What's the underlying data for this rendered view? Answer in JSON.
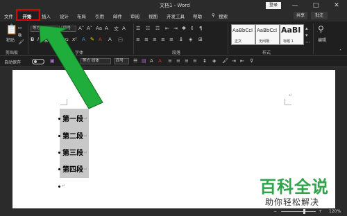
{
  "window": {
    "title": "文档1 - Word",
    "login_label": "登录",
    "controls": [
      "—",
      "□",
      "✕"
    ]
  },
  "tabs": {
    "file": "文件",
    "home": "开始",
    "insert": "插入",
    "design": "设计",
    "layout": "布局",
    "references": "引用",
    "mailings": "邮件",
    "review": "审阅",
    "view": "视图",
    "developer": "开发工具",
    "help": "帮助",
    "search": "搜索",
    "share": "共享",
    "comment": "批注"
  },
  "ribbon": {
    "paste_label": "粘贴",
    "clipboard_label": "剪贴板",
    "font_label": "字体",
    "paragraph_label": "段落",
    "styles_label": "样式",
    "editing_label": "编辑",
    "font_name": "等方",
    "font_size": "四号",
    "styles": [
      {
        "sample": "AaBbCcI",
        "name": "正文"
      },
      {
        "sample": "AaBbCcI",
        "name": "无间隔"
      },
      {
        "sample": "AaBl",
        "name": "标题 1"
      }
    ]
  },
  "qat": {
    "autosave_label": "自动保存",
    "toggle_state": "关",
    "font_name": "等方 线体",
    "font_size": "四号"
  },
  "document": {
    "lines": [
      "第一段",
      "第二段",
      "第三段",
      "第四段"
    ],
    "para_mark": "↵"
  },
  "statusbar": {
    "zoom": "120%"
  },
  "watermark": {
    "main": "百科全说",
    "sub": "助你轻松解决"
  },
  "colors": {
    "highlight_box": "#e00000",
    "arrow": "#1fae3b",
    "watermark": "#2ea34a"
  }
}
